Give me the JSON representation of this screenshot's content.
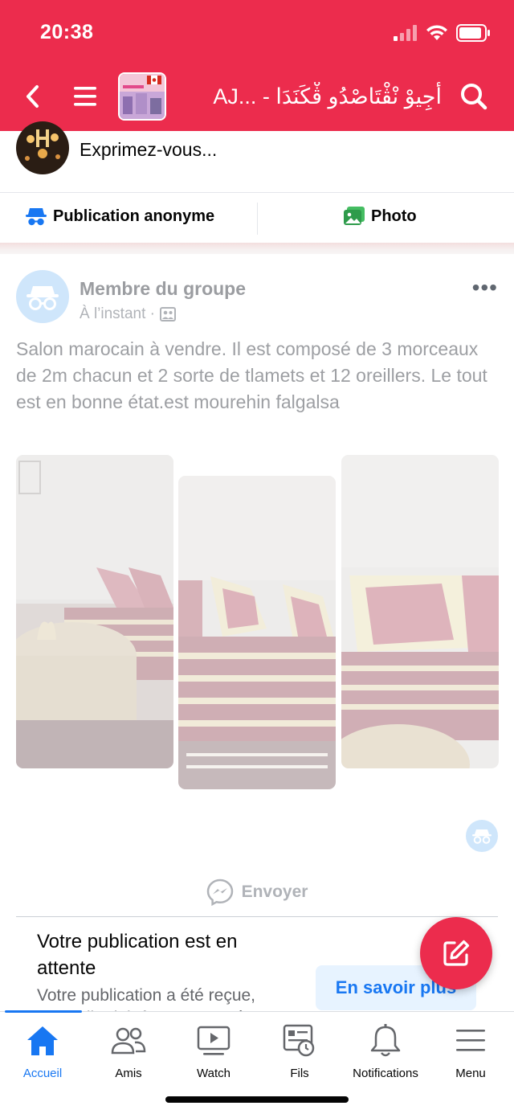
{
  "status_bar": {
    "time": "20:38"
  },
  "header": {
    "group_title": "أَجِيوْ نْڤْتَاصْدُو ڤْكَنَدَا - ...AJ",
    "icons": [
      "back-icon",
      "hamburger-icon",
      "search-icon"
    ]
  },
  "composer": {
    "prompt": "Exprimez-vous...",
    "anonymous_label": "Publication anonyme",
    "photo_label": "Photo"
  },
  "post": {
    "author": "Membre du groupe",
    "time": "À l’instant ·",
    "more": "•••",
    "text": "Salon marocain à vendre. Il est composé de 3 morceaux de 2m chacun et 2 sorte de tlamets et 12 oreillers. Le tout est en bonne état.est mourehin falgalsa",
    "send_label": "Envoyer"
  },
  "pending": {
    "title": "Votre publication est en attente",
    "body": "Votre publication a été reçue, mais elle doit être approuvée",
    "learn_more": "En savoir plus"
  },
  "tabs": [
    {
      "label": "Accueil",
      "icon": "home-icon",
      "active": true
    },
    {
      "label": "Amis",
      "icon": "friends-icon",
      "active": false
    },
    {
      "label": "Watch",
      "icon": "watch-icon",
      "active": false
    },
    {
      "label": "Fils",
      "icon": "feeds-icon",
      "active": false
    },
    {
      "label": "Notifications",
      "icon": "bell-icon",
      "active": false
    },
    {
      "label": "Menu",
      "icon": "menu-icon",
      "active": false
    }
  ],
  "colors": {
    "brand_header": "#ec2c4d",
    "accent_blue": "#1877f2",
    "learn_more_bg": "#e7f3ff"
  }
}
